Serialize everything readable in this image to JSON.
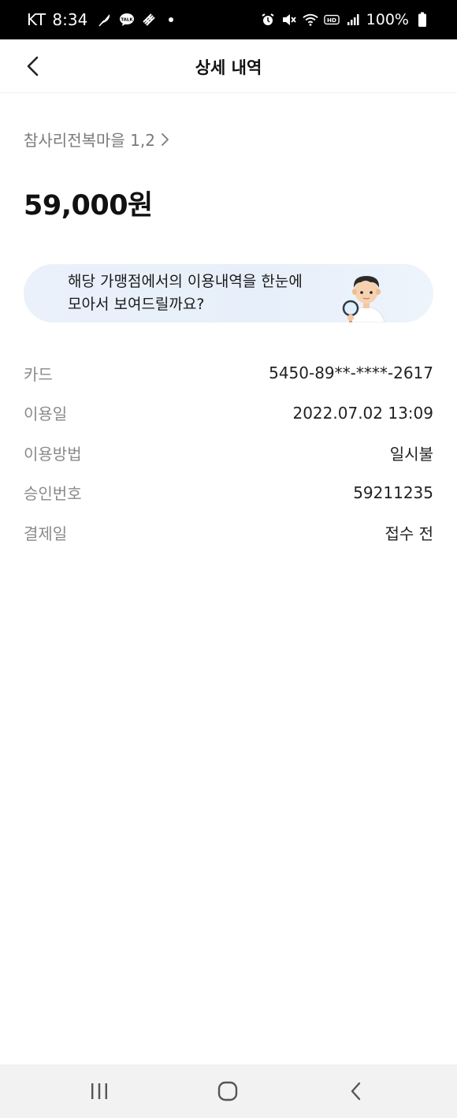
{
  "status_bar": {
    "carrier": "KT",
    "time": "8:34",
    "battery": "100%",
    "left_icons": [
      "feather-icon",
      "talk-icon",
      "rocket-icon",
      "dot-icon"
    ],
    "right_icons": [
      "alarm-icon",
      "mute-icon",
      "wifi-icon",
      "hd-icon",
      "signal-icon",
      "battery-icon"
    ]
  },
  "header": {
    "title": "상세 내역"
  },
  "merchant": {
    "name": "참사리전복마을 1,2"
  },
  "amount": "59,000원",
  "banner": {
    "line1": "해당 가맹점에서의 이용내역을 한눈에",
    "line2": "모아서 보여드릴까요?"
  },
  "details": [
    {
      "label": "카드",
      "value": "5450-89**-****-2617"
    },
    {
      "label": "이용일",
      "value": "2022.07.02 13:09"
    },
    {
      "label": "이용방법",
      "value": "일시불"
    },
    {
      "label": "승인번호",
      "value": "59211235"
    },
    {
      "label": "결제일",
      "value": "접수 전"
    }
  ],
  "colors": {
    "banner_bg": "#e8f0fa",
    "label": "#8a8a8a",
    "status_bar": "#000000",
    "nav_bar": "#f2f2f2"
  }
}
